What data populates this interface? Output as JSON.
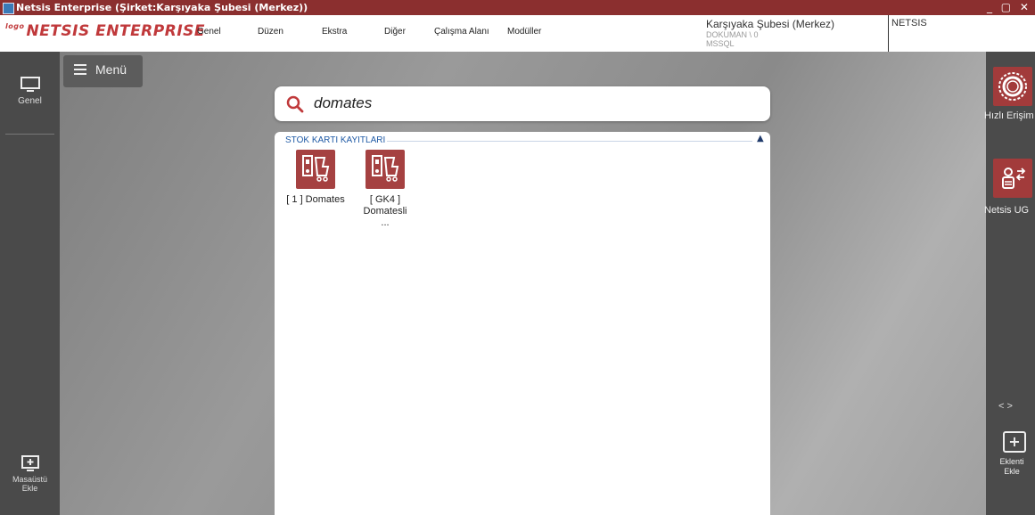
{
  "window": {
    "title": "Netsis Enterprise (Şirket:Karşıyaka Şubesi (Merkez))",
    "controls": "_ ▢ ✕"
  },
  "brand": {
    "logo_prefix": "logo",
    "logo": "NETSIS ENTERPRISE",
    "color": "#c0393b"
  },
  "menu": {
    "items": [
      "Genel",
      "Düzen",
      "Ekstra",
      "Diğer",
      "Çalışma Alanı",
      "Modüller"
    ]
  },
  "company": {
    "name": "Karşıyaka Şubesi (Merkez)",
    "db": "DOKUMAN \\ 0",
    "server": "MSSQL",
    "product": "NETSIS"
  },
  "left_sidebar": {
    "genel_label": "Genel",
    "add_desktop_line1": "Masaüstü",
    "add_desktop_line2": "Ekle"
  },
  "menu_button": {
    "label": "Menü"
  },
  "search": {
    "value": "domates"
  },
  "results": {
    "group_title": "STOK KARTI KAYITLARI",
    "items": [
      {
        "label": "[ 1 ] Domates"
      },
      {
        "label": "[ GK4 ] Domatesli ..."
      }
    ]
  },
  "right_sidebar": {
    "quick_access": "Hızlı Erişim",
    "netsis_ug": "Netsis UG",
    "nav": "<   >",
    "add_plugin_line1": "Eklenti",
    "add_plugin_line2": "Ekle"
  },
  "colors": {
    "titlebar": "#8b2f2f",
    "accent": "#a54141",
    "group_text": "#1f5aa5"
  }
}
